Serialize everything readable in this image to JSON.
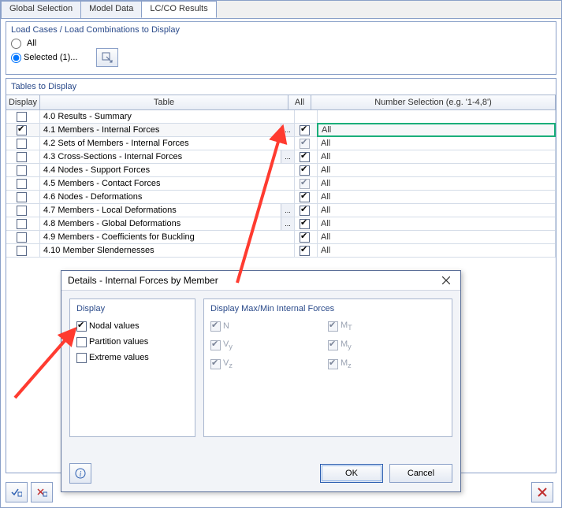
{
  "tabs": [
    "Global Selection",
    "Model Data",
    "LC/CO Results"
  ],
  "active_tab": 2,
  "load_group": {
    "title": "Load Cases / Load Combinations to Display",
    "all": "All",
    "selected": "Selected (1)..."
  },
  "tables_group": {
    "title": "Tables to Display",
    "headers": {
      "display": "Display",
      "table": "Table",
      "all": "All",
      "selection": "Number Selection (e.g. '1-4,8')"
    },
    "rows": [
      {
        "display": false,
        "table": "4.0 Results - Summary",
        "dots": false,
        "all": null,
        "sel": ""
      },
      {
        "display": true,
        "table": "4.1 Members - Internal Forces",
        "dots": true,
        "all": true,
        "sel": "All",
        "selected": true,
        "highlight": true
      },
      {
        "display": false,
        "table": "4.2 Sets of Members - Internal Forces",
        "dots": false,
        "all": true,
        "all_grey": true,
        "sel": "All"
      },
      {
        "display": false,
        "table": "4.3 Cross-Sections - Internal Forces",
        "dots": true,
        "all": true,
        "sel": "All"
      },
      {
        "display": false,
        "table": "4.4 Nodes - Support Forces",
        "dots": false,
        "all": true,
        "sel": "All"
      },
      {
        "display": false,
        "table": "4.5 Members - Contact Forces",
        "dots": false,
        "all": true,
        "all_grey": true,
        "sel": "All"
      },
      {
        "display": false,
        "table": "4.6 Nodes - Deformations",
        "dots": false,
        "all": true,
        "sel": "All"
      },
      {
        "display": false,
        "table": "4.7 Members - Local Deformations",
        "dots": true,
        "all": true,
        "sel": "All"
      },
      {
        "display": false,
        "table": "4.8 Members - Global Deformations",
        "dots": true,
        "all": true,
        "sel": "All"
      },
      {
        "display": false,
        "table": "4.9 Members - Coefficients for Buckling",
        "dots": false,
        "all": true,
        "sel": "All"
      },
      {
        "display": false,
        "table": "4.10 Member Slendernesses",
        "dots": false,
        "all": true,
        "sel": "All"
      }
    ]
  },
  "dialog": {
    "title": "Details - Internal Forces by Member",
    "display_title": "Display",
    "maxmin_title": "Display Max/Min Internal Forces",
    "opts": {
      "nodal": "Nodal values",
      "partition": "Partition values",
      "extreme": "Extreme values"
    },
    "forces": {
      "n": "N",
      "vy": "V",
      "vz": "V",
      "mt": "M",
      "my": "M",
      "mz": "M",
      "vy_sub": "y",
      "vz_sub": "z",
      "mt_sub": "T",
      "my_sub": "y",
      "mz_sub": "z"
    },
    "ok": "OK",
    "cancel": "Cancel"
  }
}
